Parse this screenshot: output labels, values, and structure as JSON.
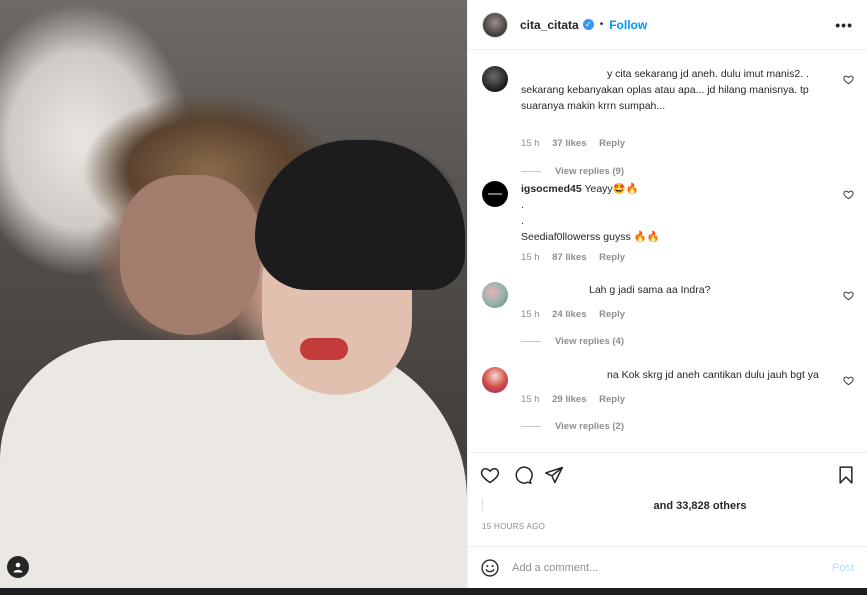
{
  "post": {
    "author": "cita_citata",
    "verified_mark": "✓",
    "follow_label": "Follow",
    "separator": "•",
    "more_label": "•••"
  },
  "comments": [
    {
      "text": "y cita sekarang jd aneh. dulu imut manis2. . sekarang kebanyakan oplas atau apa... jd hilang manisnya. tp suaranya makin krrn sumpah...",
      "time": "15 h",
      "likes": "37 likes",
      "reply_label": "Reply",
      "view_replies": "View replies (9)"
    },
    {
      "username": "igsocmed45",
      "line1": "Yeayy🤩🔥",
      "line2": ".",
      "line3": ".",
      "line4": "Seediaf0llowerss guyss 🔥🔥",
      "time": "15 h",
      "likes": "87 likes",
      "reply_label": "Reply"
    },
    {
      "text": "Lah g jadi sama aa Indra?",
      "time": "15 h",
      "likes": "24 likes",
      "reply_label": "Reply",
      "view_replies": "View replies (4)"
    },
    {
      "text": "na Kok skrg jd aneh cantikan dulu jauh bgt ya",
      "time": "15 h",
      "likes": "29 likes",
      "reply_label": "Reply",
      "view_replies": "View replies (2)"
    }
  ],
  "likes_summary": "and 33,828 others",
  "timestamp": "15 HOURS AGO",
  "add_comment": {
    "placeholder": "Add a comment...",
    "post_label": "Post"
  },
  "icons": {
    "heart": "heart-icon",
    "comment": "comment-icon",
    "share": "share-icon",
    "save": "bookmark-icon",
    "emoji": "emoji-icon",
    "tag": "user-tag-icon"
  },
  "colors": {
    "accent": "#0095f6",
    "verified": "#3897f0",
    "muted": "#8e8e8e",
    "post_disabled": "#b2dffc"
  }
}
